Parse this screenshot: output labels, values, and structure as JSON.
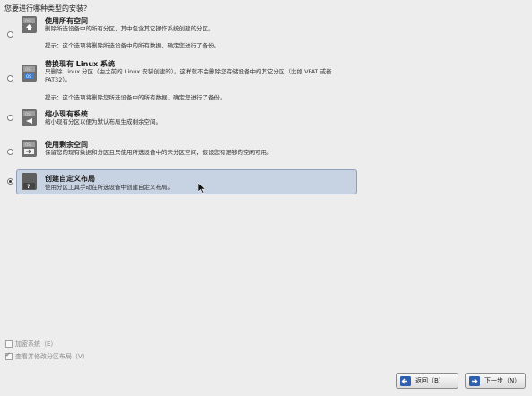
{
  "prompt": "您要进行哪种类型的安装？",
  "options": [
    {
      "title": "使用所有空间",
      "desc": "删除所选设备中的所有分区，其中包含其它操作系统创建的分区。",
      "note": "提示：这个选项将删除所选设备中的所有数据，确定您进行了备份。",
      "icon": "disk-wipe-icon",
      "selected": false
    },
    {
      "title": "替换现有 Linux 系统",
      "desc": "只删除 Linux 分区（由之前的 Linux 安装创建的）。这样就不会删除您存储设备中的其它分区（比如 VFAT 或者 FAT32）。",
      "note": "提示：这个选项将删除您所选设备中的所有数据，确定您进行了备份。",
      "icon": "disk-replace-icon",
      "selected": false
    },
    {
      "title": "缩小现有系统",
      "desc": "缩小现有分区以便为默认布局生成剩余空间。",
      "note": "",
      "icon": "disk-shrink-icon",
      "selected": false
    },
    {
      "title": "使用剩余空间",
      "desc": "保留您的现有数据和分区且只使用所选设备中的未分区空间，假设您有足够的空闲可用。",
      "note": "",
      "icon": "disk-free-space-icon",
      "selected": false
    },
    {
      "title": "创建自定义布局",
      "desc": "使用分区工具手动在所选设备中创建自定义布局。",
      "note": "",
      "icon": "disk-custom-icon",
      "selected": true
    }
  ],
  "checkboxes": {
    "encrypt": {
      "label": "加密系统（E）",
      "checked": false
    },
    "review": {
      "label": "查看并修改分区布局（V）",
      "checked": true
    }
  },
  "buttons": {
    "back": "返回（B）",
    "next": "下一步（N）"
  }
}
